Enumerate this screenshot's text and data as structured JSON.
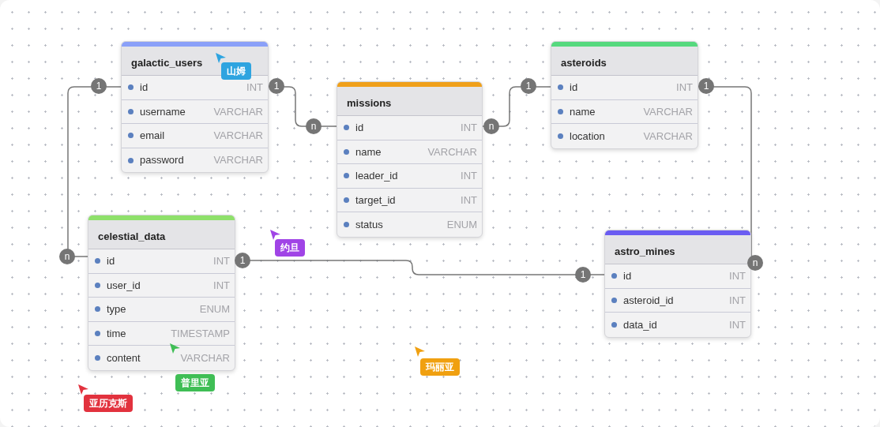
{
  "tables": [
    {
      "name": "galactic_users",
      "color": "#8aa0f8",
      "fields": [
        {
          "name": "id",
          "type": "INT"
        },
        {
          "name": "username",
          "type": "VARCHAR"
        },
        {
          "name": "email",
          "type": "VARCHAR"
        },
        {
          "name": "password",
          "type": "VARCHAR"
        }
      ]
    },
    {
      "name": "missions",
      "color": "#f0a01a",
      "fields": [
        {
          "name": "id",
          "type": "INT"
        },
        {
          "name": "name",
          "type": "VARCHAR"
        },
        {
          "name": "leader_id",
          "type": "INT"
        },
        {
          "name": "target_id",
          "type": "INT"
        },
        {
          "name": "status",
          "type": "ENUM"
        }
      ]
    },
    {
      "name": "asteroids",
      "color": "#56d97e",
      "fields": [
        {
          "name": "id",
          "type": "INT"
        },
        {
          "name": "name",
          "type": "VARCHAR"
        },
        {
          "name": "location",
          "type": "VARCHAR"
        }
      ]
    },
    {
      "name": "celestial_data",
      "color": "#8ee06a",
      "fields": [
        {
          "name": "id",
          "type": "INT"
        },
        {
          "name": "user_id",
          "type": "INT"
        },
        {
          "name": "type",
          "type": "ENUM"
        },
        {
          "name": "time",
          "type": "TIMESTAMP"
        },
        {
          "name": "content",
          "type": "VARCHAR"
        }
      ]
    },
    {
      "name": "astro_mines",
      "color": "#6a5cf2",
      "fields": [
        {
          "name": "id",
          "type": "INT"
        },
        {
          "name": "asteroid_id",
          "type": "INT"
        },
        {
          "name": "data_id",
          "type": "INT"
        }
      ]
    }
  ],
  "relationships": [
    {
      "from_label": "1",
      "to_label": "n"
    },
    {
      "from_label": "1",
      "to_label": "n"
    },
    {
      "from_label": "n",
      "to_label": "1"
    },
    {
      "from_label": "1",
      "to_label": "n"
    },
    {
      "from_label": "1",
      "to_label": "1"
    }
  ],
  "cursors": [
    {
      "name": "山姆",
      "color": "#2ea4e0"
    },
    {
      "name": "约旦",
      "color": "#a044e6"
    },
    {
      "name": "普里亚",
      "color": "#3fbe55"
    },
    {
      "name": "玛丽亚",
      "color": "#f0a010"
    },
    {
      "name": "亚历克斯",
      "color": "#e2323e"
    }
  ]
}
